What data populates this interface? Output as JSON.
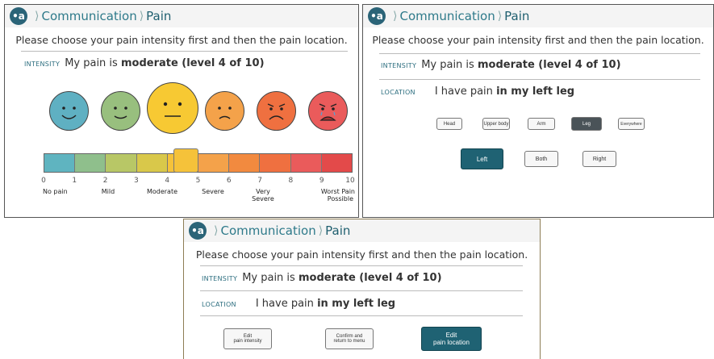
{
  "logo_text": "•a",
  "breadcrumb": {
    "parent": "Communication",
    "current": "Pain",
    "separator": "⟩"
  },
  "instruction": "Please choose your pain intensity first and then the pain location.",
  "intensity": {
    "label": "INTENSITY",
    "prefix": "My pain is",
    "value": "moderate (level 4 of 10)"
  },
  "location": {
    "label": "LOCATION",
    "prefix": "I have pain",
    "value": "in my left leg"
  },
  "faces": [
    {
      "color": "#5fb0c2",
      "mood": "happy"
    },
    {
      "color": "#98bf7e",
      "mood": "slight-smile"
    },
    {
      "color": "#f7c933",
      "mood": "neutral",
      "selected": true
    },
    {
      "color": "#f4a24a",
      "mood": "slight-frown"
    },
    {
      "color": "#ef7040",
      "mood": "sad"
    },
    {
      "color": "#ea5b5b",
      "mood": "crying"
    }
  ],
  "scale": {
    "colors": [
      "#5fb4c0",
      "#5fb4c0",
      "#8fbf8c",
      "#b8c766",
      "#d9c84a",
      "#f5c23a",
      "#f4a24a",
      "#f28a3f",
      "#ef7040",
      "#ea5b5b",
      "#e34a4a"
    ],
    "numbers": [
      "0",
      "1",
      "2",
      "3",
      "4",
      "5",
      "6",
      "7",
      "8",
      "9",
      "10"
    ],
    "selected_level": 4,
    "words": [
      {
        "at": "0",
        "text": "No pain"
      },
      {
        "at": "1",
        "text": "Mild"
      },
      {
        "at": "3",
        "text": "Moderate"
      },
      {
        "at": "5",
        "text": "Severe"
      },
      {
        "at": "7a",
        "text": "Very"
      },
      {
        "at": "7b",
        "text": "Severe"
      },
      {
        "at": "10a",
        "text": "Worst Pain"
      },
      {
        "at": "10b",
        "text": "Possible"
      }
    ]
  },
  "body_parts": [
    "Head",
    "Upper body",
    "Arm",
    "Leg",
    "Everywhere"
  ],
  "body_part_selected": "Leg",
  "sides": [
    "Left",
    "Both",
    "Right"
  ],
  "side_selected": "Left",
  "actions": {
    "edit_intensity": "Edit\npain intensity",
    "confirm": "Confirm and\nreturn to menu",
    "edit_location": "Edit\npain location"
  }
}
